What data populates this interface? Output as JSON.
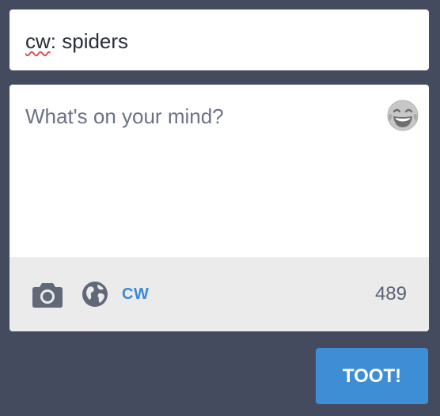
{
  "content_warning": {
    "prefix": "cw",
    "rest": ": spiders"
  },
  "status": {
    "placeholder": "What's on your mind?",
    "value": ""
  },
  "toolbar": {
    "camera_icon": "camera-icon",
    "globe_icon": "globe-icon",
    "cw_label": "CW",
    "char_count": "489"
  },
  "emoji_icon": "laughing-face-emoji-icon",
  "submit": {
    "label": "TOOT!"
  },
  "colors": {
    "background": "#454b5e",
    "accent": "#3e8ed6",
    "cw_link": "#3a8ad4",
    "toolbar_bg": "#ebebeb",
    "icon": "#616878"
  }
}
